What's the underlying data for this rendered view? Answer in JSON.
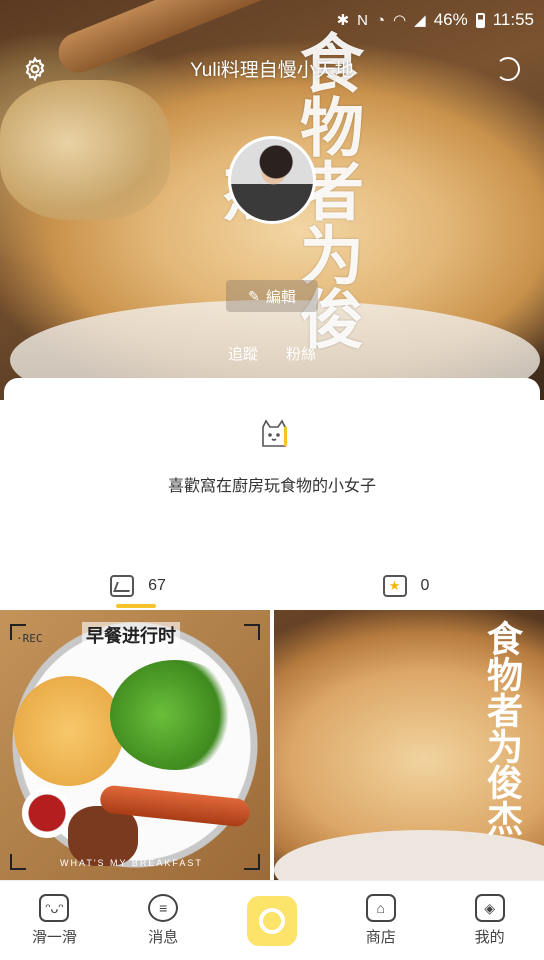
{
  "status_bar": {
    "battery": "46%",
    "time": "11:55"
  },
  "header": {
    "title": "Yuli料理自慢小天地",
    "edit_label": "編輯",
    "following_label": "追蹤",
    "followers_label": "粉絲",
    "cover_calligraphy": "食物者为俊杰"
  },
  "profile": {
    "bio": "喜歡窩在廚房玩食物的小女子"
  },
  "tabs": [
    {
      "name": "photos",
      "count": "67",
      "active": true
    },
    {
      "name": "favorites",
      "count": "0",
      "active": false
    }
  ],
  "grid": {
    "tile1_banner": "早餐进行时",
    "tile1_rec": "·REC",
    "tile1_caption": "WHAT'S MY BREAKFAST",
    "tile2_calligraphy": "食物者为俊杰"
  },
  "bottom_nav": {
    "items": [
      {
        "label": "滑一滑",
        "icon": "face-icon"
      },
      {
        "label": "消息",
        "icon": "message-icon"
      },
      {
        "label": "",
        "icon": "camera-icon"
      },
      {
        "label": "商店",
        "icon": "shop-icon"
      },
      {
        "label": "我的",
        "icon": "profile-icon"
      }
    ]
  },
  "colors": {
    "accent": "#f6c42a",
    "camera_button": "#fce36a"
  }
}
